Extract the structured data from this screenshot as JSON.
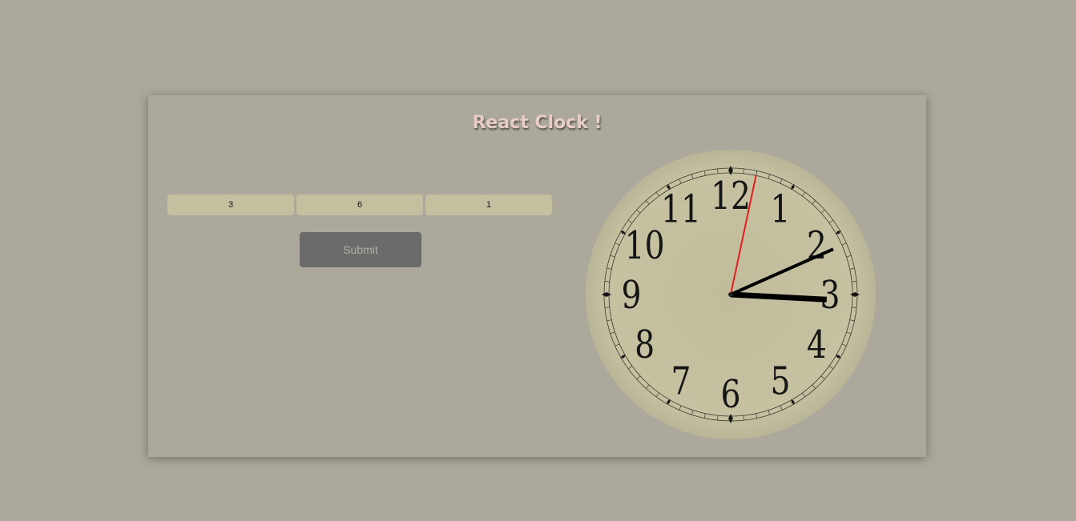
{
  "title": "React Clock !",
  "inputs": [
    {
      "value": "3",
      "name": "hours"
    },
    {
      "value": "6",
      "name": "minutes"
    },
    {
      "value": "1",
      "name": "seconds"
    }
  ],
  "submit_label": "Submit",
  "clock": {
    "numerals": [
      "12",
      "1",
      "2",
      "3",
      "4",
      "5",
      "6",
      "7",
      "8",
      "9",
      "10",
      "11"
    ],
    "time_shown": {
      "hour": 3,
      "minute": 6,
      "second": 1
    },
    "colors": {
      "face": "#c3bf9f",
      "numerals": "#151515",
      "hands": "#000000",
      "second_hand": "#e41e1e"
    }
  }
}
